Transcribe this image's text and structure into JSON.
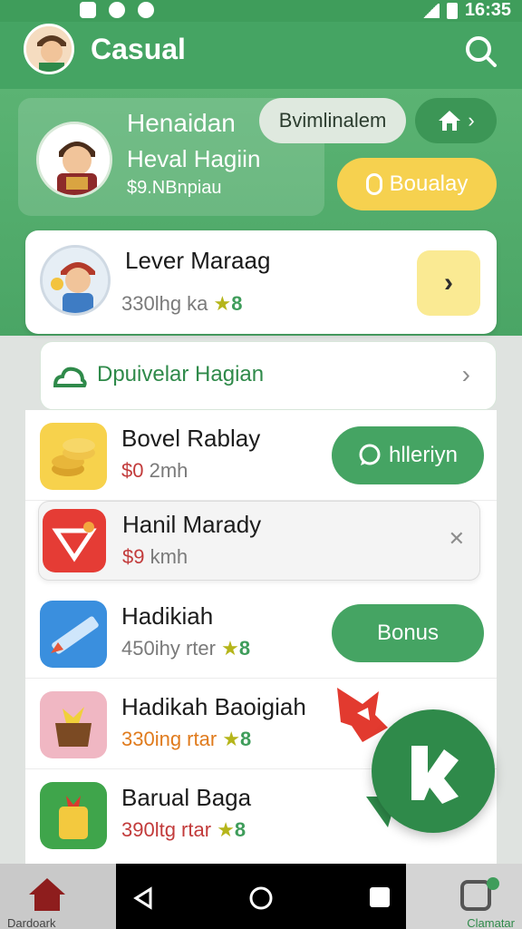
{
  "status_bar": {
    "time": "16:35"
  },
  "app_bar": {
    "title": "Casual",
    "icons": {
      "avatar": "user-avatar",
      "search": "search-icon"
    }
  },
  "hero": {
    "name": "Henaidan",
    "subtitle": "Heval Hagiin",
    "amount": "$9.NBnpiau",
    "pill_grey_label": "Bvimlinalem",
    "pill_home_icon": "home-icon",
    "pill_yellow_label": "Boualay"
  },
  "featured": {
    "title": "Lever Maraag",
    "meta_value": "330lhg ka",
    "meta_badge": "8",
    "action_icon": "chevron-right-icon"
  },
  "section": {
    "title": "Dpuivelar Hagian"
  },
  "items": [
    {
      "title": "Bovel Rablay",
      "meta_price": "$0",
      "meta_rest": " 2mh",
      "action_label": "hlleriyn",
      "action_icon": "chat-icon",
      "icon": "coins-icon"
    },
    {
      "title": "Hanil Marady",
      "meta_price": "$9",
      "meta_rest": " kmh",
      "close_icon": "close-icon",
      "icon": "heart-tag-icon"
    },
    {
      "title": "Hadikiah",
      "meta_value": "450ihy rter",
      "meta_badge": "8",
      "action_label": "Bonus",
      "icon": "ruler-icon"
    },
    {
      "title": "Hadikah Baoigiah",
      "meta_value": "330ing rtar",
      "meta_badge": "8",
      "icon": "basket-icon"
    },
    {
      "title": "Barual Baga",
      "meta_value": "390ltg rtar",
      "meta_badge": "8",
      "icon": "gift-pot-icon"
    }
  ],
  "bottom_nav": {
    "left_label": "Dardoark",
    "right_label": "Clamatar",
    "left_icon": "home-icon",
    "right_icon": "apps-icon"
  },
  "colors": {
    "primary": "#45a463",
    "accent_yellow": "#f6d14f",
    "accent_red": "#d84343"
  }
}
